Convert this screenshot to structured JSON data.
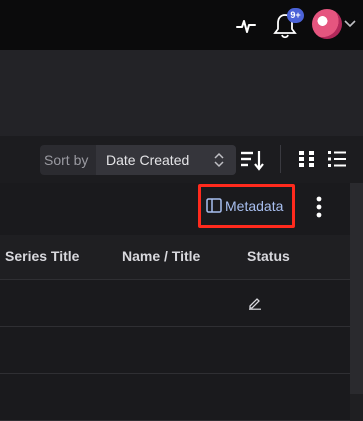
{
  "header": {
    "notification_badge": "9+",
    "icons": [
      "pulse-icon",
      "bell-icon",
      "avatar",
      "chevron-down-icon"
    ]
  },
  "toolbar": {
    "sort_label": "Sort by",
    "sort_value": "Date Created",
    "icons": [
      "sort-direction-icon",
      "grid-view-icon",
      "list-view-icon"
    ]
  },
  "metadata": {
    "button_label": "Metadata",
    "highlight_color": "#ff2a1d"
  },
  "table": {
    "columns": [
      "Series Title",
      "Name / Title",
      "Status"
    ],
    "rows": [
      {
        "series_title": "",
        "name_title": "",
        "status_icon": "edit-icon"
      },
      {
        "series_title": "",
        "name_title": "",
        "status_icon": ""
      },
      {
        "series_title": "",
        "name_title": "",
        "status_icon": ""
      }
    ]
  }
}
